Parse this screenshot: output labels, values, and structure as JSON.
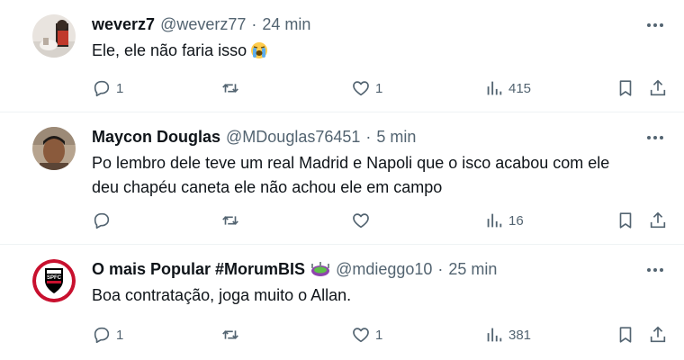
{
  "tweets": [
    {
      "name": "weverz7",
      "handle": "@weverz77",
      "dot": "·",
      "time": "24 min",
      "text": "Ele, ele não faria isso",
      "emoji": "loudly-crying-face",
      "replies": "1",
      "retweets": "",
      "likes": "1",
      "views": "415"
    },
    {
      "name": "Maycon Douglas",
      "handle": "@MDouglas76451",
      "dot": "·",
      "time": "5 min",
      "text_line1": "Po lembro dele teve um real Madrid e Napoli que o isco acabou com ele",
      "text_line2": "deu chapéu caneta ele não achou ele em campo",
      "replies": "",
      "retweets": "",
      "likes": "",
      "views": "16"
    },
    {
      "name": "O mais Popular #MorumBIS",
      "badge": "stadium-icon",
      "handle": "@mdieggo10",
      "dot": "·",
      "time": "25 min",
      "text": "Boa contratação, joga muito o Allan.",
      "replies": "1",
      "retweets": "",
      "likes": "1",
      "views": "381"
    }
  ],
  "colors": {
    "text": "#0f1419",
    "secondary": "#536471",
    "divider": "#eff3f4"
  }
}
